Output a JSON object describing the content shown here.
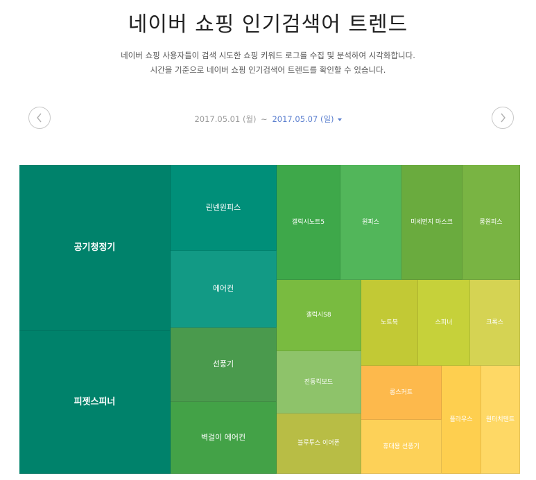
{
  "page": {
    "title": "네이버 쇼핑 인기검색어 트렌드",
    "desc_line1": "네이버 쇼핑 사용자들이 검색 시도한 쇼핑 키워드 로그를 수집 및 분석하여 시각화합니다.",
    "desc_line2": "시간을 기준으로 네이버 쇼핑 인기검색어 트렌드를 확인할 수 있습니다."
  },
  "date_range": {
    "start": "2017.05.01 (월)",
    "separator": "~",
    "end": "2017.05.07 (일)"
  },
  "nav": {
    "prev_icon": "chevron-left-icon",
    "next_icon": "chevron-right-icon"
  },
  "treemap": {
    "items": [
      {
        "label": "공기청정기",
        "color": "#00826b"
      },
      {
        "label": "피젯스피너",
        "color": "#00826b"
      },
      {
        "label": "린넨원피스",
        "color": "#008f79"
      },
      {
        "label": "에어컨",
        "color": "#129a85"
      },
      {
        "label": "선풍기",
        "color": "#4a9a4d"
      },
      {
        "label": "벽걸이 에어컨",
        "color": "#43a247"
      },
      {
        "label": "갤럭시노트5",
        "color": "#3ea84a"
      },
      {
        "label": "원피스",
        "color": "#52b65a"
      },
      {
        "label": "미세먼지 마스크",
        "color": "#6aab3e"
      },
      {
        "label": "롱원피스",
        "color": "#79b443"
      },
      {
        "label": "갤럭시S8",
        "color": "#79bb40"
      },
      {
        "label": "노트북",
        "color": "#c2c935"
      },
      {
        "label": "스피너",
        "color": "#c6d13a"
      },
      {
        "label": "크록스",
        "color": "#d5d353"
      },
      {
        "label": "전동킥보드",
        "color": "#8ec36a"
      },
      {
        "label": "블루투스 이어폰",
        "color": "#b8bd45"
      },
      {
        "label": "롱스커트",
        "color": "#fdb94c"
      },
      {
        "label": "휴대용 선풍기",
        "color": "#fdd158"
      },
      {
        "label": "플라우스",
        "color": "#fecf4f"
      },
      {
        "label": "원터치텐트",
        "color": "#fed865"
      }
    ]
  }
}
